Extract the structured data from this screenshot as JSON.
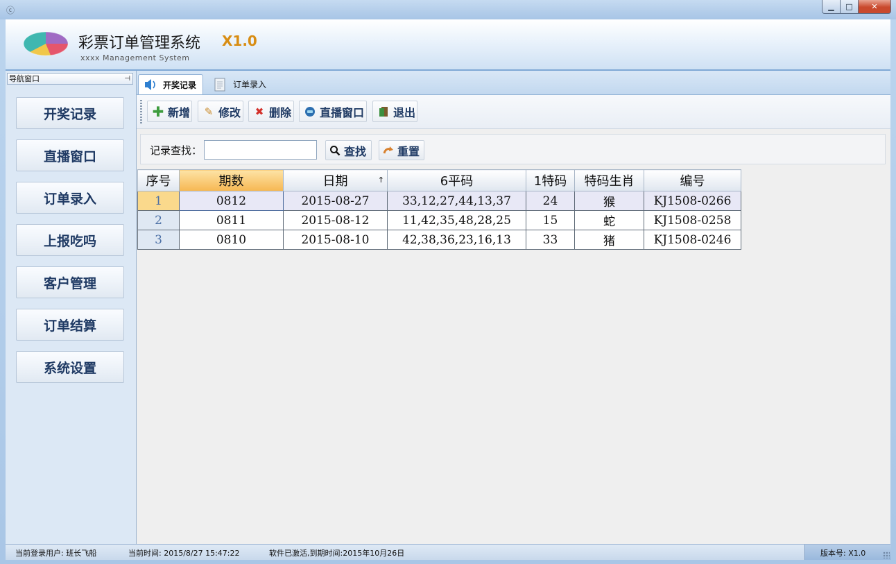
{
  "window": {
    "controls": {
      "minimize": "▁",
      "maximize": "□",
      "close": "✕"
    }
  },
  "header": {
    "title": "彩票订单管理系统",
    "version": "X1.0",
    "subtitle": "xxxx Management System"
  },
  "nav": {
    "header_label": "导航窗口",
    "pin_icon": "pin-icon",
    "items": [
      {
        "label": "开奖记录"
      },
      {
        "label": "直播窗口"
      },
      {
        "label": "订单录入"
      },
      {
        "label": "上报吃吗"
      },
      {
        "label": "客户管理"
      },
      {
        "label": "订单结算"
      },
      {
        "label": "系统设置"
      }
    ]
  },
  "tabs": [
    {
      "label": "开奖记录",
      "active": true,
      "icon": "speaker-icon"
    },
    {
      "label": "订单录入",
      "active": false,
      "icon": "document-icon"
    }
  ],
  "toolbar": {
    "add_label": "新增",
    "edit_label": "修改",
    "delete_label": "删除",
    "live_label": "直播窗口",
    "exit_label": "退出"
  },
  "search": {
    "label": "记录查找：",
    "value": "",
    "placeholder": "",
    "find_label": "查找",
    "reset_label": "重置"
  },
  "grid": {
    "columns": [
      "序号",
      "期数",
      "日期",
      "6平码",
      "1特码",
      "特码生肖",
      "编号"
    ],
    "sort_indicator": "↑",
    "rows": [
      [
        "1",
        "0812",
        "2015-08-27",
        "33,12,27,44,13,37",
        "24",
        "猴",
        "KJ1508-0266"
      ],
      [
        "2",
        "0811",
        "2015-08-12",
        "11,42,35,48,28,25",
        "15",
        "蛇",
        "KJ1508-0258"
      ],
      [
        "3",
        "0810",
        "2015-08-10",
        "42,38,36,23,16,13",
        "33",
        "猪",
        "KJ1508-0246"
      ]
    ]
  },
  "status": {
    "user": "当前登录用户: 班长飞船",
    "time": "当前时间: 2015/8/27 15:47:22",
    "license": "软件已激活,到期时间:2015年10月26日",
    "version": "版本号: X1.0"
  },
  "colors": {
    "accent": "#d88d14",
    "nav_text": "#1f3a64",
    "selected_row_header": "#fad98c"
  }
}
